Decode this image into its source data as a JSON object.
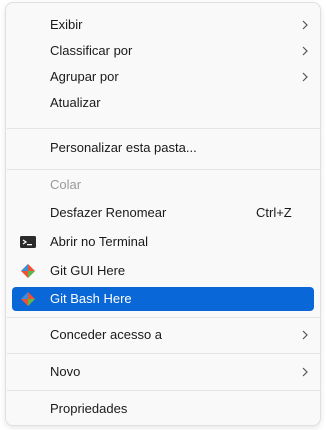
{
  "menu": {
    "items": [
      {
        "label": "Exibir",
        "arrow": ">"
      },
      {
        "label": "Classificar por",
        "arrow": ">"
      },
      {
        "label": "Agrupar por",
        "arrow": ">"
      },
      {
        "label": "Atualizar"
      },
      {
        "label": "Personalizar esta pasta..."
      },
      {
        "label": "Colar",
        "disabled": true
      },
      {
        "label": "Desfazer Renomear",
        "shortcut": "Ctrl+Z"
      },
      {
        "label": "Abrir no Terminal",
        "icon": "terminal-icon"
      },
      {
        "label": "Git GUI Here",
        "icon": "git-diamond-icon"
      },
      {
        "label": "Git Bash Here",
        "icon": "git-diamond-icon",
        "selected": true
      },
      {
        "label": "Conceder acesso a",
        "arrow": ">"
      },
      {
        "label": "Novo",
        "arrow": ">"
      },
      {
        "label": "Propriedades"
      }
    ]
  },
  "colors": {
    "selected_bg": "#0a67d8",
    "git_orange": "#f05033",
    "git_blue": "#3a8fd8",
    "git_green": "#5bb84a"
  }
}
